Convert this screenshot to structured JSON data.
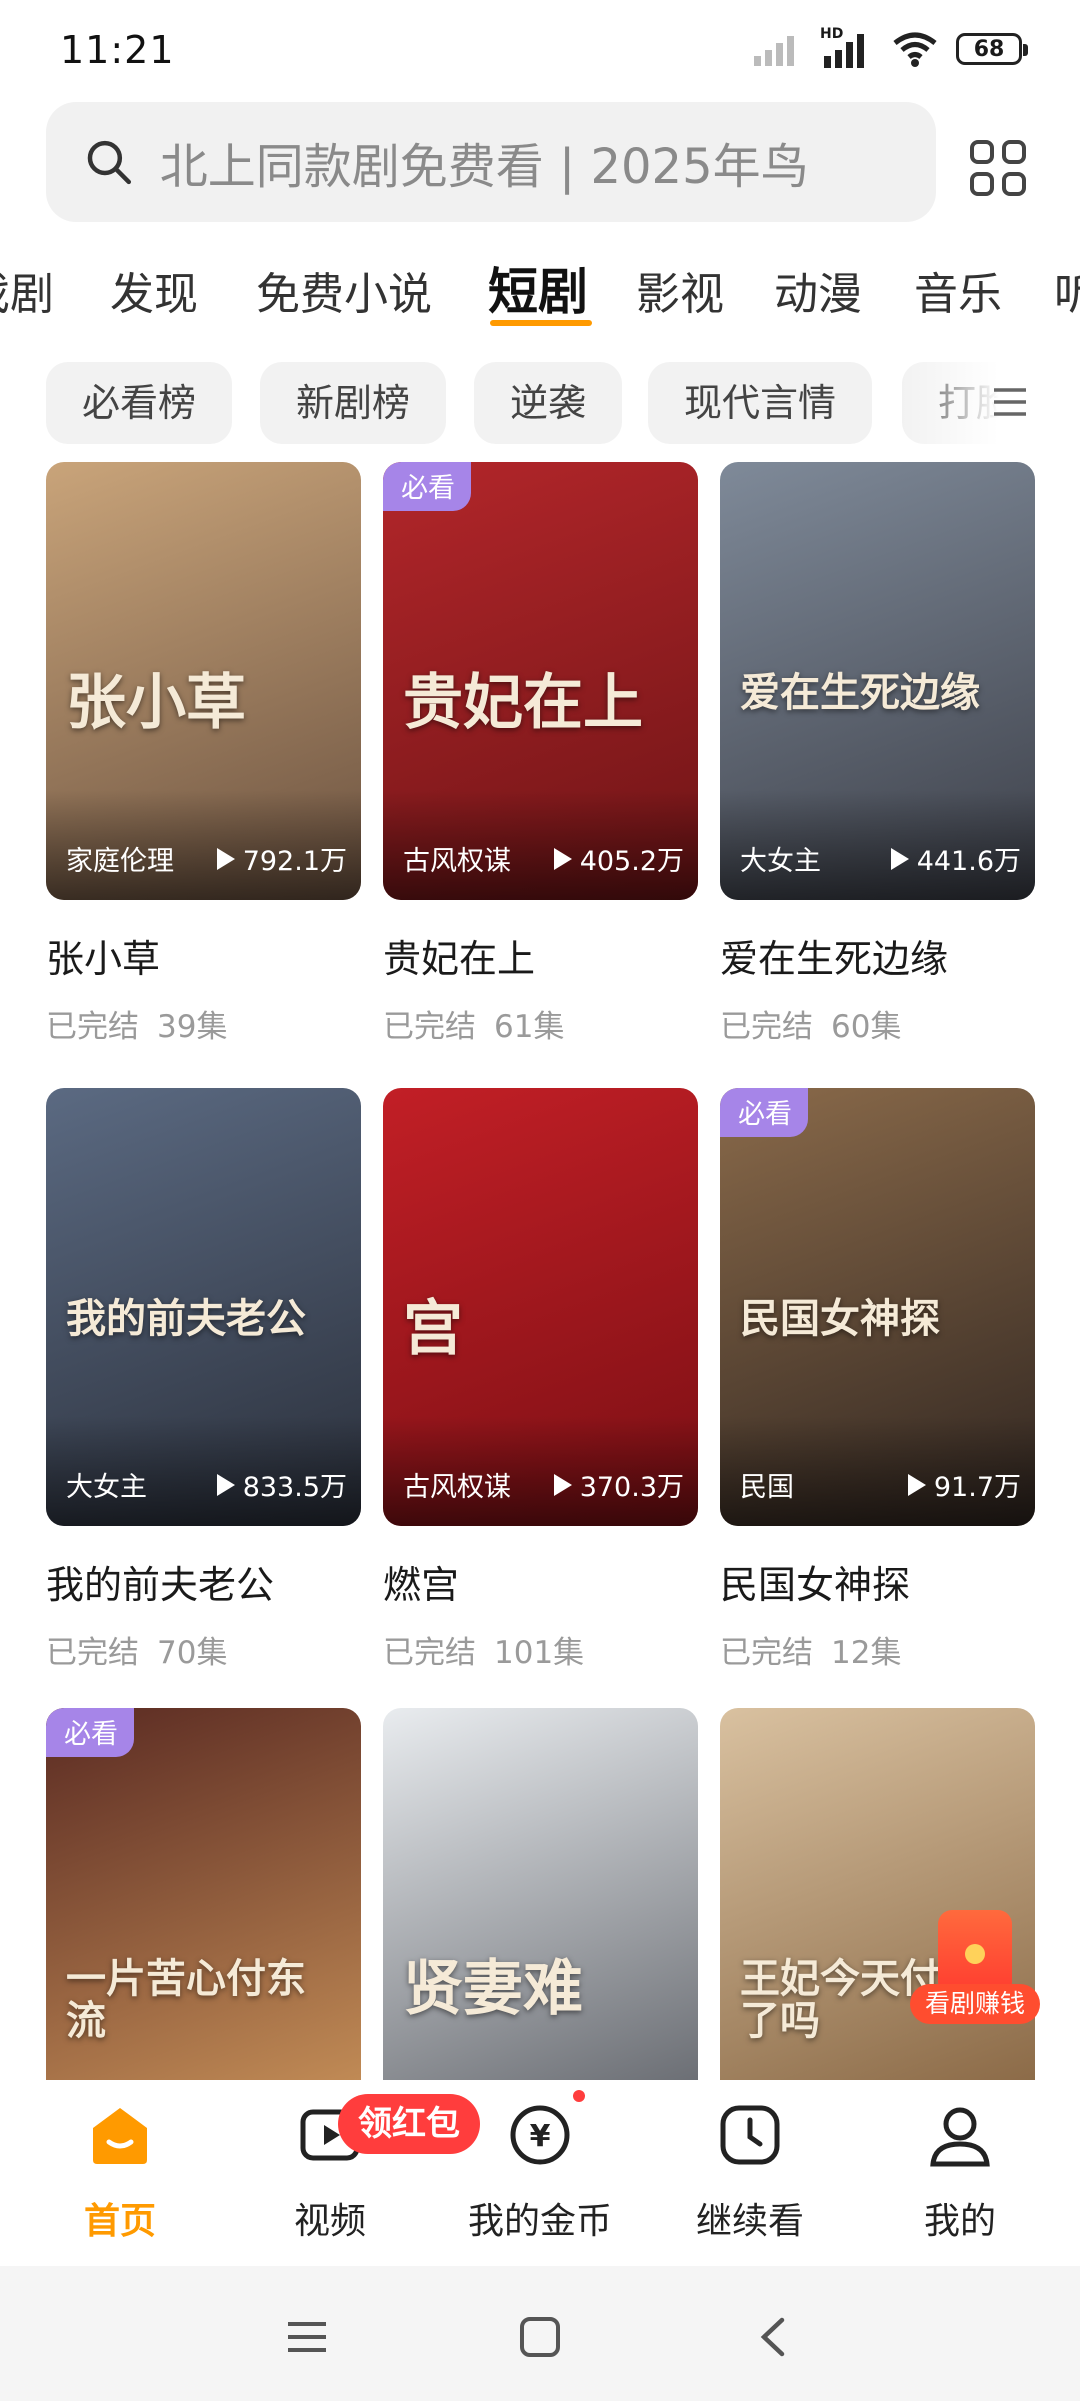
{
  "status_bar": {
    "time": "11:21",
    "network_label": "HD",
    "battery": "68"
  },
  "search": {
    "placeholder": "北上同款剧免费看 | 2025年鸟"
  },
  "tabs": [
    {
      "label": "戏剧"
    },
    {
      "label": "发现"
    },
    {
      "label": "免费小说"
    },
    {
      "label": "短剧",
      "active": true
    },
    {
      "label": "影视"
    },
    {
      "label": "动漫"
    },
    {
      "label": "音乐"
    },
    {
      "label": "听"
    }
  ],
  "chips": [
    {
      "label": "必看榜"
    },
    {
      "label": "新剧榜"
    },
    {
      "label": "逆袭"
    },
    {
      "label": "现代言情"
    },
    {
      "label": "打脸"
    }
  ],
  "shows": [
    {
      "title": "张小草",
      "status": "已完结",
      "episodes": "39集",
      "tag": "家庭伦理",
      "plays": "792.1万",
      "badge": "",
      "poster_text": "张小草",
      "colors": [
        "#c9a47a",
        "#6b5240"
      ]
    },
    {
      "title": "贵妃在上",
      "status": "已完结",
      "episodes": "61集",
      "tag": "古风权谋",
      "plays": "405.2万",
      "badge": "必看",
      "poster_text": "贵妃在上",
      "colors": [
        "#b3262a",
        "#6e1416"
      ]
    },
    {
      "title": "爱在生死边缘",
      "status": "已完结",
      "episodes": "60集",
      "tag": "大女主",
      "plays": "441.6万",
      "badge": "",
      "poster_text": "爱在生死边缘",
      "colors": [
        "#7f8a99",
        "#3c3f48"
      ]
    },
    {
      "title": "我的前夫老公",
      "status": "已完结",
      "episodes": "70集",
      "tag": "大女主",
      "plays": "833.5万",
      "badge": "",
      "poster_text": "我的前夫老公",
      "colors": [
        "#5b6a82",
        "#2a2f3a"
      ]
    },
    {
      "title": "燃宫",
      "status": "已完结",
      "episodes": "101集",
      "tag": "古风权谋",
      "plays": "370.3万",
      "badge": "",
      "poster_text": "宫",
      "colors": [
        "#c21f26",
        "#7a0f14"
      ]
    },
    {
      "title": "民国女神探",
      "status": "已完结",
      "episodes": "12集",
      "tag": "民国",
      "plays": "91.7万",
      "badge": "必看",
      "poster_text": "民国女神探",
      "colors": [
        "#8a6a4a",
        "#2f2520"
      ]
    },
    {
      "title": "",
      "status": "",
      "episodes": "",
      "tag": "",
      "plays": "",
      "badge": "必看",
      "poster_text": "一片苦心付东流",
      "colors": [
        "#5a2a22",
        "#c08a55"
      ]
    },
    {
      "title": "",
      "status": "",
      "episodes": "",
      "tag": "",
      "plays": "",
      "badge": "",
      "poster_text": "贤妻难",
      "colors": [
        "#e9ecef",
        "#6c6f75"
      ]
    },
    {
      "title": "",
      "status": "",
      "episodes": "",
      "tag": "",
      "plays": "",
      "badge": "",
      "poster_text": "王妃今天付夫了吗",
      "colors": [
        "#d9c1a0",
        "#8c6b48"
      ]
    }
  ],
  "floating_widget": {
    "label": "看剧赚钱"
  },
  "bottom_nav": {
    "items": [
      {
        "label": "首页",
        "icon": "home-icon",
        "active": true
      },
      {
        "label": "视频",
        "icon": "video-icon"
      },
      {
        "label": "我的金币",
        "icon": "coin-icon"
      },
      {
        "label": "继续看",
        "icon": "clock-icon"
      },
      {
        "label": "我的",
        "icon": "profile-icon"
      }
    ],
    "promo_badge": "领红包"
  },
  "colors": {
    "accent": "#ff9a00",
    "badge_purple": "#a685e8",
    "red_badge": "#ff3d3d"
  }
}
